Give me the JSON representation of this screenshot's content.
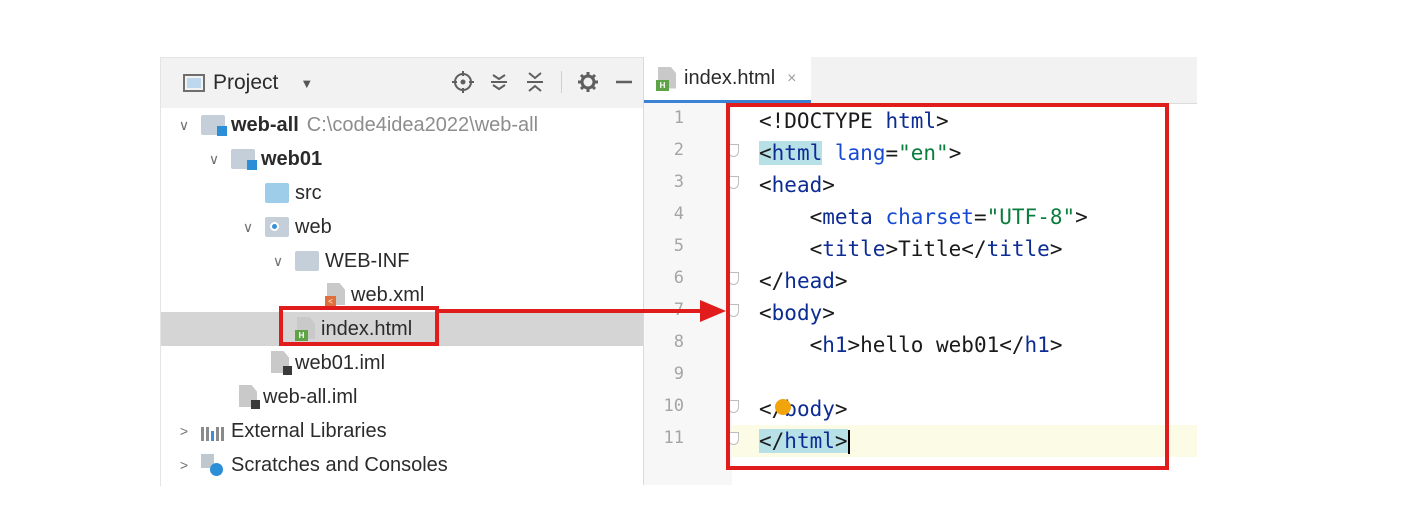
{
  "project_panel": {
    "title": "Project",
    "tree": [
      {
        "label": "web-all",
        "path": "C:\\code4idea2022\\web-all"
      },
      {
        "label": "web01"
      },
      {
        "label": "src"
      },
      {
        "label": "web"
      },
      {
        "label": "WEB-INF"
      },
      {
        "label": "web.xml"
      },
      {
        "label": "index.html"
      },
      {
        "label": "web01.iml"
      },
      {
        "label": "web-all.iml"
      },
      {
        "label": "External Libraries"
      },
      {
        "label": "Scratches and Consoles"
      }
    ]
  },
  "editor": {
    "tab_label": "index.html",
    "tab_close": "×",
    "line_numbers": [
      "1",
      "2",
      "3",
      "4",
      "5",
      "6",
      "7",
      "8",
      "9",
      "10",
      "11"
    ]
  },
  "icons": {
    "panel": "project-panel-icon",
    "dropdown": "chevron-down-icon",
    "locate": "crosshair-icon",
    "expand": "expand-all-icon",
    "collapse": "collapse-all-icon",
    "settings": "gear-icon",
    "hide": "minimize-icon"
  },
  "colors": {
    "annotation": "#e01c1c",
    "selection": "#d5d5d5",
    "tag": "#0c2c94",
    "attribute": "#174ad4",
    "string": "#0a7d3d"
  }
}
